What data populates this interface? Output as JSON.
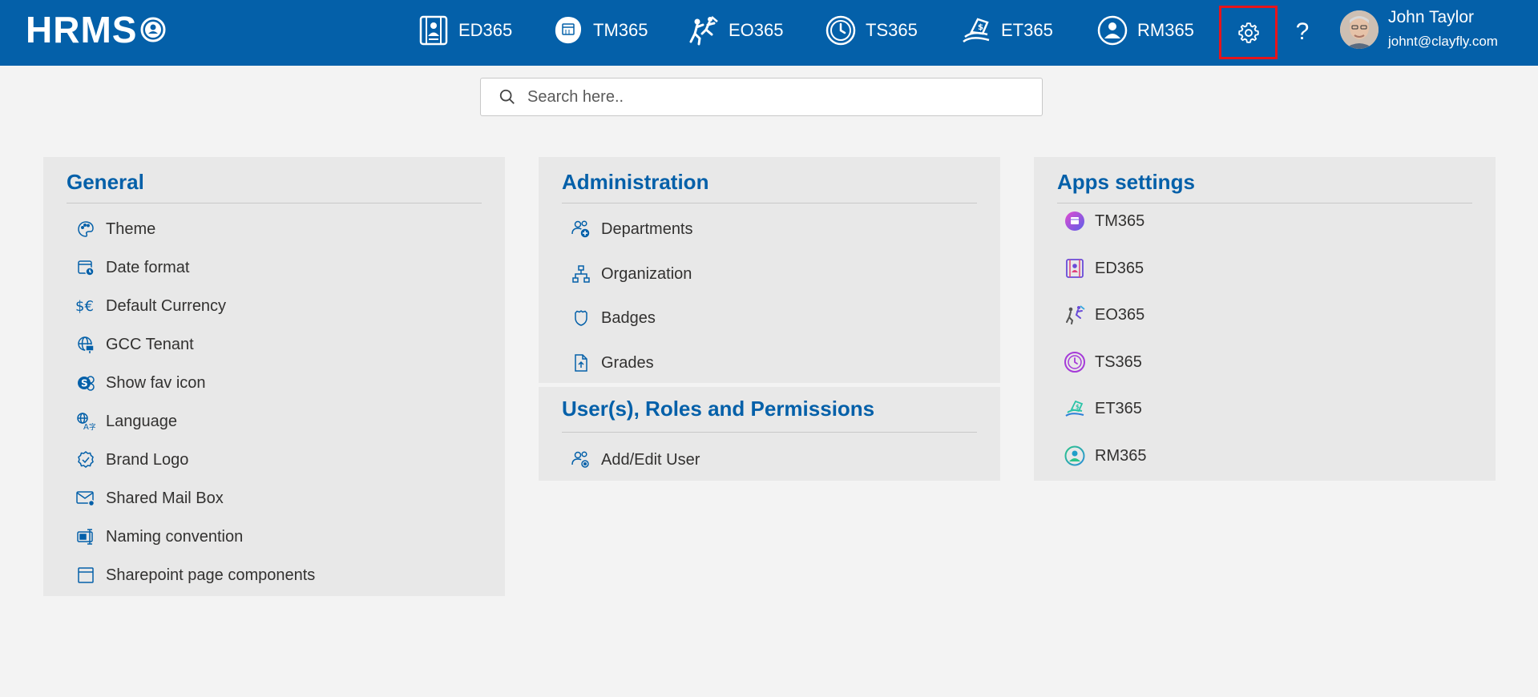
{
  "header": {
    "brand": "HRMS",
    "apps": [
      {
        "label": "ED365",
        "icon": "ed365-icon"
      },
      {
        "label": "TM365",
        "icon": "tm365-icon"
      },
      {
        "label": "EO365",
        "icon": "eo365-icon"
      },
      {
        "label": "TS365",
        "icon": "ts365-icon"
      },
      {
        "label": "ET365",
        "icon": "et365-icon"
      },
      {
        "label": "RM365",
        "icon": "rm365-icon"
      }
    ],
    "settings_icon": "gear-icon",
    "help_label": "?",
    "user": {
      "name": "John Taylor",
      "email": "johnt@clayfly.com"
    }
  },
  "search": {
    "placeholder": "Search here.."
  },
  "general": {
    "title": "General",
    "items": [
      {
        "label": "Theme",
        "icon": "palette-icon"
      },
      {
        "label": "Date format",
        "icon": "calendar-clock-icon"
      },
      {
        "label": "Default Currency",
        "icon": "currency-icon"
      },
      {
        "label": "GCC Tenant",
        "icon": "globe-desktop-icon"
      },
      {
        "label": "Show fav icon",
        "icon": "fav-icon"
      },
      {
        "label": "Language",
        "icon": "translate-icon"
      },
      {
        "label": "Brand Logo",
        "icon": "badge-check-icon"
      },
      {
        "label": "Shared Mail Box",
        "icon": "mail-settings-icon"
      },
      {
        "label": "Naming convention",
        "icon": "rename-icon"
      },
      {
        "label": "Sharepoint page components",
        "icon": "page-icon"
      }
    ]
  },
  "administration": {
    "title": "Administration",
    "items": [
      {
        "label": "Departments",
        "icon": "people-add-icon"
      },
      {
        "label": "Organization",
        "icon": "org-chart-icon"
      },
      {
        "label": "Badges",
        "icon": "shield-icon"
      },
      {
        "label": "Grades",
        "icon": "document-arrow-up-icon"
      }
    ]
  },
  "users": {
    "title": "User(s), Roles and Permissions",
    "items": [
      {
        "label": "Add/Edit User",
        "icon": "people-settings-icon"
      }
    ]
  },
  "apps_settings": {
    "title": "Apps settings",
    "items": [
      {
        "label": "TM365",
        "icon": "tm365-icon"
      },
      {
        "label": "ED365",
        "icon": "ed365-icon"
      },
      {
        "label": "EO365",
        "icon": "eo365-icon"
      },
      {
        "label": "TS365",
        "icon": "ts365-icon"
      },
      {
        "label": "ET365",
        "icon": "et365-icon"
      },
      {
        "label": "RM365",
        "icon": "rm365-icon"
      }
    ]
  },
  "colors": {
    "header": "#0460a9",
    "accent": "#0460a9",
    "highlight": "#e8141b",
    "panel": "#e8e8e8",
    "background": "#f3f3f3"
  }
}
